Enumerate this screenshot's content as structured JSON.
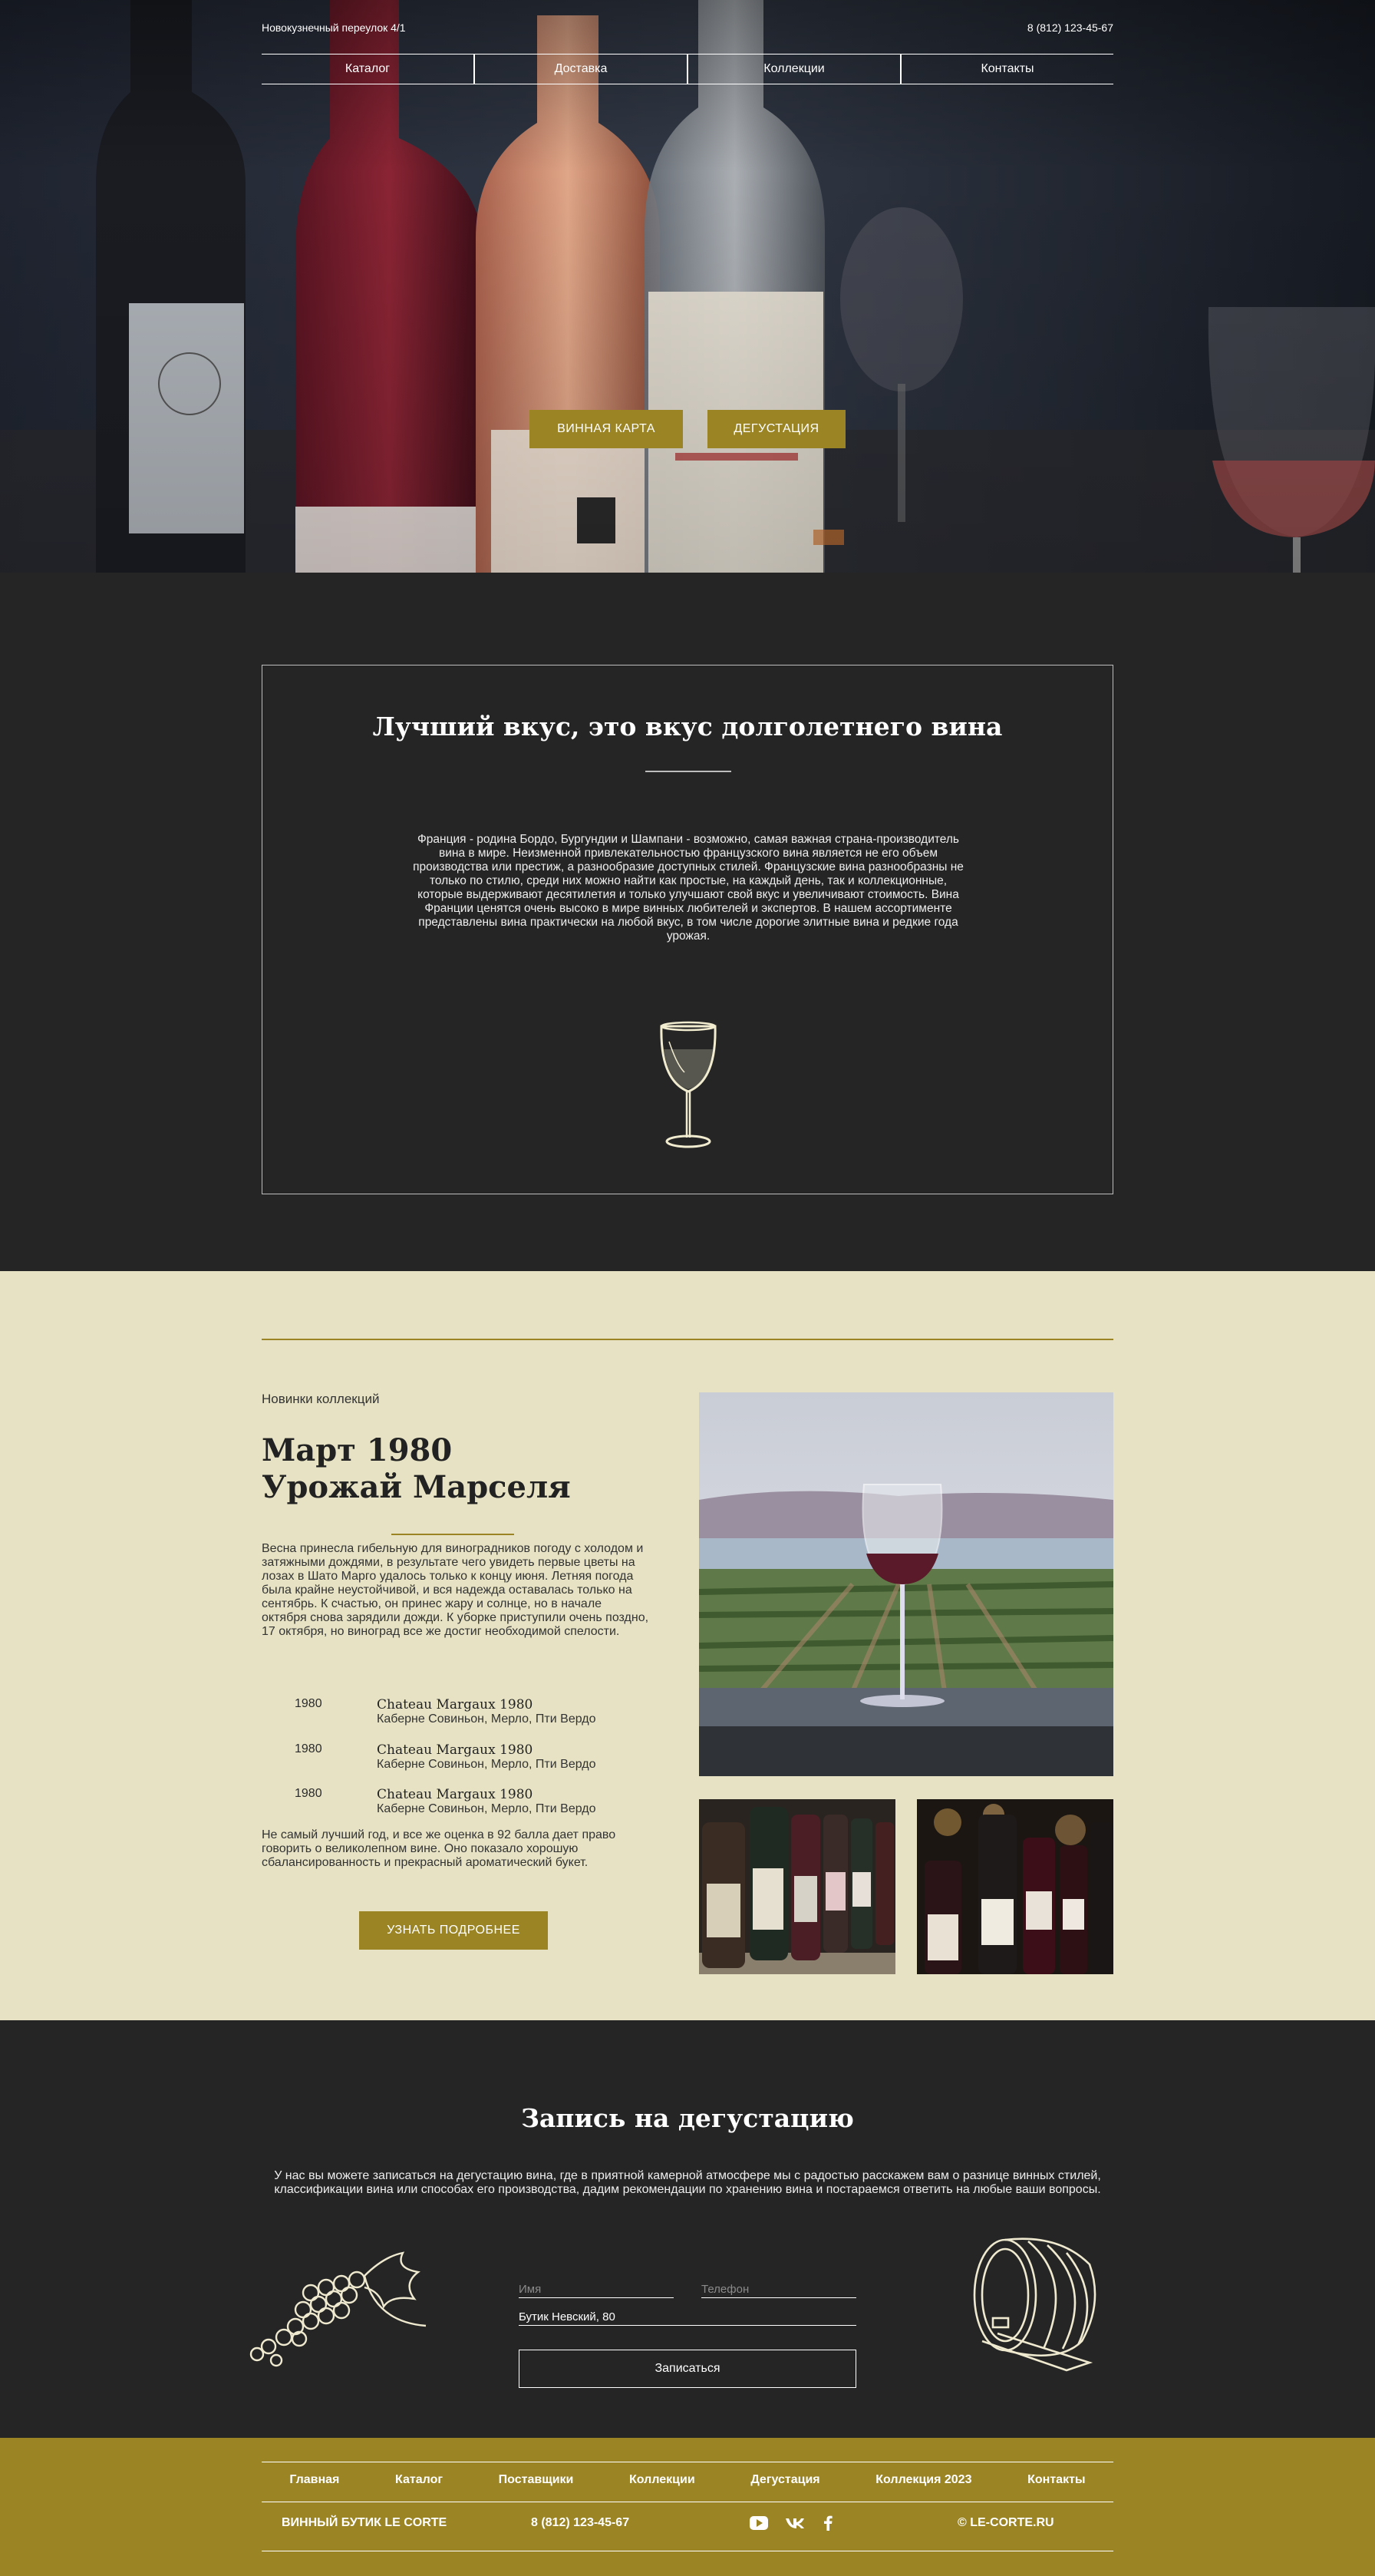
{
  "header": {
    "address": "Новокузнечный переулок 4/1",
    "phone": "8 (812) 123-45-67",
    "nav": [
      "Каталог",
      "Доставка",
      "Коллекции",
      "Контакты"
    ],
    "btn_wine_list": "ВИННАЯ КАРТА",
    "btn_tasting": "ДЕГУСТАЦИЯ"
  },
  "about": {
    "title": "Лучший вкус, это вкус долголетнего вина",
    "text": "Франция - родина Бордо, Бургундии и Шампани - возможно, самая важная страна-производитель вина в мире. Неизменной привлекательностью французского вина является не его объем производства или престиж, а разнообразие доступных стилей. Французские вина разнообразны не только по стилю, среди них можно найти как простые, на каждый день, так и коллекционные, которые выдерживают десятилетия и только улучшают свой вкус и увеличивают стоимость. Вина Франции ценятся очень высоко в мире винных любителей и экспертов. В нашем ассортименте представлены вина практически на любой вкус, в том числе дорогие элитные вина и редкие года урожая.",
    "icon": "wine-glass-icon"
  },
  "collection": {
    "tag": "Новинки коллекций",
    "title_line1": "Март 1980",
    "title_line2": "Урожай Марселя",
    "text": "Весна принесла гибельную для виноградников погоду с холодом и затяжными дождями, в результате чего увидеть первые цветы на лозах в Шато Марго удалось только к концу июня. Летняя погода была крайне неустойчивой, и вся надежда оставалась только на сентябрь. К счастью, он принес жару и солнце, но в начале октября снова зарядили дожди. К уборке приступили очень поздно, 17 октября, но виноград все же достиг необходимой спелости.",
    "wines": [
      {
        "year": "1980",
        "name": "Chateau Margaux 1980",
        "grapes": "Каберне Совиньон, Мерло, Пти Вердо"
      },
      {
        "year": "1980",
        "name": "Chateau Margaux 1980",
        "grapes": "Каберне Совиньон, Мерло, Пти Вердо"
      },
      {
        "year": "1980",
        "name": "Chateau Margaux 1980",
        "grapes": "Каберне Совиньон, Мерло, Пти Вердо"
      }
    ],
    "text2": "Не самый лучший год, и все же оценка в 92 балла дает право говорить о великолепном вине. Оно показало хорошую сбалансированность и прекрасный ароматический букет.",
    "btn_more": "УЗНАТЬ ПОДРОБНЕЕ"
  },
  "tasting": {
    "title": "Запись на дегустацию",
    "text": "У нас вы можете записаться на дегустацию вина, где в приятной камерной атмосфере мы с радостью расскажем вам о разнице винных стилей, классификации вина или способах его производства, дадим рекомендации по хранению вина и постараемся ответить на любые ваши вопросы.",
    "name_placeholder": "Имя",
    "phone_placeholder": "Телефон",
    "location_value": "Бутик Невский, 80",
    "submit_label": "Записаться"
  },
  "footer": {
    "nav": [
      "Главная",
      "Каталог",
      "Поставщики",
      "Коллекции",
      "Дегустация",
      "Коллекция 2023",
      "Контакты"
    ],
    "brand": "ВИННЫЙ БУТИК LE CORTE",
    "phone": "8 (812) 123-45-67",
    "social": [
      "youtube-icon",
      "vk-icon",
      "facebook-icon"
    ],
    "site": "© LE-CORTE.RU"
  },
  "colors": {
    "gold": "#9a8424",
    "dark": "#252525",
    "cream": "#e6e2c3"
  }
}
